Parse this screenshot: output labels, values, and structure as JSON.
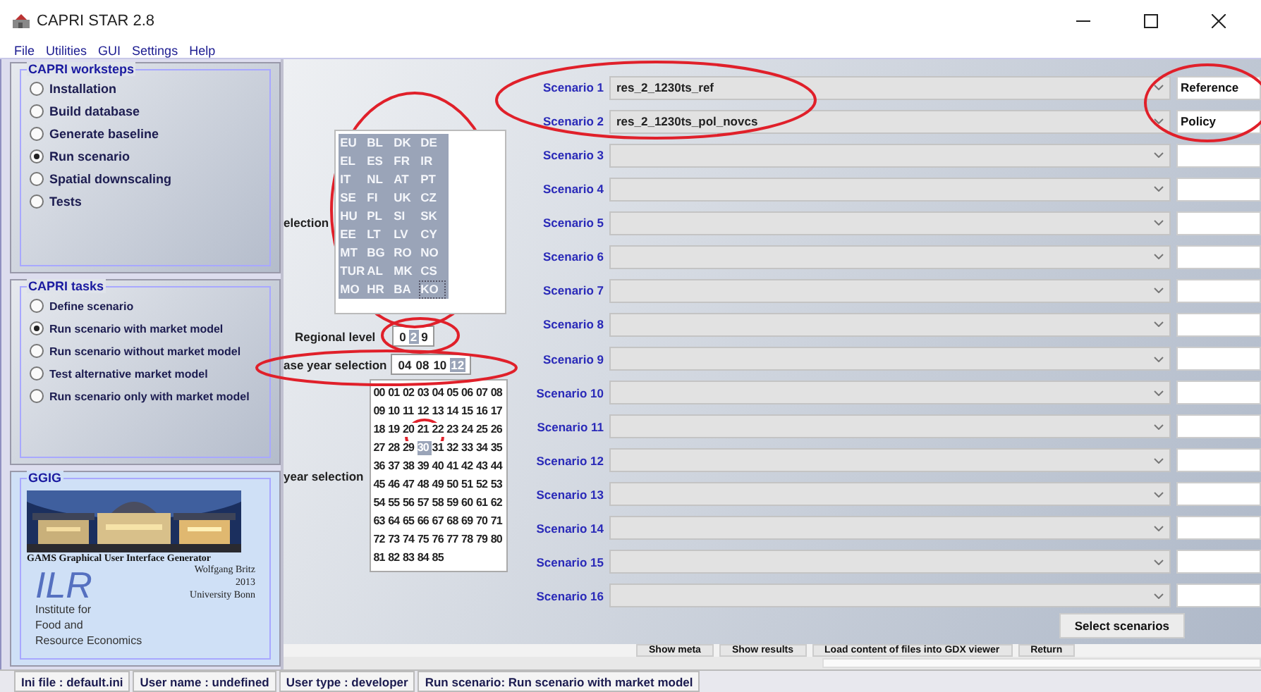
{
  "window": {
    "title": "CAPRI STAR 2.8"
  },
  "menu": [
    "File",
    "Utilities",
    "GUI",
    "Settings",
    "Help"
  ],
  "worksteps": {
    "title": "CAPRI worksteps",
    "items": [
      {
        "label": "Installation",
        "selected": false
      },
      {
        "label": "Build database",
        "selected": false
      },
      {
        "label": "Generate baseline",
        "selected": false
      },
      {
        "label": "Run scenario",
        "selected": true
      },
      {
        "label": "Spatial downscaling",
        "selected": false
      },
      {
        "label": "Tests",
        "selected": false
      }
    ]
  },
  "tasks": {
    "title": "CAPRI tasks",
    "items": [
      {
        "label": "Define scenario",
        "selected": false
      },
      {
        "label": "Run scenario with market model",
        "selected": true
      },
      {
        "label": "Run scenario without market model",
        "selected": false
      },
      {
        "label": "Test alternative market model",
        "selected": false
      },
      {
        "label": "Run scenario only with market model",
        "selected": false
      }
    ]
  },
  "about": {
    "title": "GGIG",
    "generator": "GAMS Graphical User Interface Generator",
    "author": "Wolfgang Britz",
    "year": "2013",
    "university": "University Bonn",
    "logo": "ILR",
    "institute": [
      "Institute  for",
      "Food and",
      "Resource Economics"
    ]
  },
  "regions": {
    "label": "election",
    "items": [
      {
        "code": "EU",
        "selected": true
      },
      {
        "code": "BL",
        "selected": true
      },
      {
        "code": "DK",
        "selected": true
      },
      {
        "code": "DE",
        "selected": true
      },
      {
        "code": "EL",
        "selected": true
      },
      {
        "code": "ES",
        "selected": true
      },
      {
        "code": "FR",
        "selected": true
      },
      {
        "code": "IR",
        "selected": true
      },
      {
        "code": "IT",
        "selected": true
      },
      {
        "code": "NL",
        "selected": true
      },
      {
        "code": "AT",
        "selected": true
      },
      {
        "code": "PT",
        "selected": true
      },
      {
        "code": "SE",
        "selected": true
      },
      {
        "code": "FI",
        "selected": true
      },
      {
        "code": "UK",
        "selected": true
      },
      {
        "code": "CZ",
        "selected": true
      },
      {
        "code": "HU",
        "selected": true
      },
      {
        "code": "PL",
        "selected": true
      },
      {
        "code": "SI",
        "selected": true
      },
      {
        "code": "SK",
        "selected": true
      },
      {
        "code": "EE",
        "selected": true
      },
      {
        "code": "LT",
        "selected": true
      },
      {
        "code": "LV",
        "selected": true
      },
      {
        "code": "CY",
        "selected": true
      },
      {
        "code": "MT",
        "selected": true
      },
      {
        "code": "BG",
        "selected": true
      },
      {
        "code": "RO",
        "selected": true
      },
      {
        "code": "NO",
        "selected": true
      },
      {
        "code": "TUR",
        "selected": true
      },
      {
        "code": "AL",
        "selected": true
      },
      {
        "code": "MK",
        "selected": true
      },
      {
        "code": "CS",
        "selected": true
      },
      {
        "code": "MO",
        "selected": true
      },
      {
        "code": "HR",
        "selected": true
      },
      {
        "code": "BA",
        "selected": true
      },
      {
        "code": "KO",
        "selected": true
      }
    ]
  },
  "regional_level": {
    "label": "Regional level",
    "values": [
      {
        "text": "0",
        "selected": false
      },
      {
        "text": "2",
        "selected": true
      },
      {
        "text": "9",
        "selected": false
      }
    ]
  },
  "base_year": {
    "label": "ase year selection",
    "values": [
      {
        "text": "04",
        "selected": false
      },
      {
        "text": "08",
        "selected": false
      },
      {
        "text": "10",
        "selected": false
      },
      {
        "text": "12",
        "selected": true
      }
    ]
  },
  "years": {
    "label": "year selection",
    "items": [
      {
        "text": "00",
        "selected": false
      },
      {
        "text": "01",
        "selected": false
      },
      {
        "text": "02",
        "selected": false
      },
      {
        "text": "03",
        "selected": false
      },
      {
        "text": "04",
        "selected": false
      },
      {
        "text": "05",
        "selected": false
      },
      {
        "text": "06",
        "selected": false
      },
      {
        "text": "07",
        "selected": false
      },
      {
        "text": "08",
        "selected": false
      },
      {
        "text": "09",
        "selected": false
      },
      {
        "text": "10",
        "selected": false
      },
      {
        "text": "11",
        "selected": false
      },
      {
        "text": "12",
        "selected": false
      },
      {
        "text": "13",
        "selected": false
      },
      {
        "text": "14",
        "selected": false
      },
      {
        "text": "15",
        "selected": false
      },
      {
        "text": "16",
        "selected": false
      },
      {
        "text": "17",
        "selected": false
      },
      {
        "text": "18",
        "selected": false
      },
      {
        "text": "19",
        "selected": false
      },
      {
        "text": "20",
        "selected": false
      },
      {
        "text": "21",
        "selected": false
      },
      {
        "text": "22",
        "selected": false
      },
      {
        "text": "23",
        "selected": false
      },
      {
        "text": "24",
        "selected": false
      },
      {
        "text": "25",
        "selected": false
      },
      {
        "text": "26",
        "selected": false
      },
      {
        "text": "27",
        "selected": false
      },
      {
        "text": "28",
        "selected": false
      },
      {
        "text": "29",
        "selected": false
      },
      {
        "text": "30",
        "selected": true
      },
      {
        "text": "31",
        "selected": false
      },
      {
        "text": "32",
        "selected": false
      },
      {
        "text": "33",
        "selected": false
      },
      {
        "text": "34",
        "selected": false
      },
      {
        "text": "35",
        "selected": false
      },
      {
        "text": "36",
        "selected": false
      },
      {
        "text": "37",
        "selected": false
      },
      {
        "text": "38",
        "selected": false
      },
      {
        "text": "39",
        "selected": false
      },
      {
        "text": "40",
        "selected": false
      },
      {
        "text": "41",
        "selected": false
      },
      {
        "text": "42",
        "selected": false
      },
      {
        "text": "43",
        "selected": false
      },
      {
        "text": "44",
        "selected": false
      },
      {
        "text": "45",
        "selected": false
      },
      {
        "text": "46",
        "selected": false
      },
      {
        "text": "47",
        "selected": false
      },
      {
        "text": "48",
        "selected": false
      },
      {
        "text": "49",
        "selected": false
      },
      {
        "text": "50",
        "selected": false
      },
      {
        "text": "51",
        "selected": false
      },
      {
        "text": "52",
        "selected": false
      },
      {
        "text": "53",
        "selected": false
      },
      {
        "text": "54",
        "selected": false
      },
      {
        "text": "55",
        "selected": false
      },
      {
        "text": "56",
        "selected": false
      },
      {
        "text": "57",
        "selected": false
      },
      {
        "text": "58",
        "selected": false
      },
      {
        "text": "59",
        "selected": false
      },
      {
        "text": "60",
        "selected": false
      },
      {
        "text": "61",
        "selected": false
      },
      {
        "text": "62",
        "selected": false
      },
      {
        "text": "63",
        "selected": false
      },
      {
        "text": "64",
        "selected": false
      },
      {
        "text": "65",
        "selected": false
      },
      {
        "text": "66",
        "selected": false
      },
      {
        "text": "67",
        "selected": false
      },
      {
        "text": "68",
        "selected": false
      },
      {
        "text": "69",
        "selected": false
      },
      {
        "text": "70",
        "selected": false
      },
      {
        "text": "71",
        "selected": false
      },
      {
        "text": "72",
        "selected": false
      },
      {
        "text": "73",
        "selected": false
      },
      {
        "text": "74",
        "selected": false
      },
      {
        "text": "75",
        "selected": false
      },
      {
        "text": "76",
        "selected": false
      },
      {
        "text": "77",
        "selected": false
      },
      {
        "text": "78",
        "selected": false
      },
      {
        "text": "79",
        "selected": false
      },
      {
        "text": "80",
        "selected": false
      },
      {
        "text": "81",
        "selected": false
      },
      {
        "text": "82",
        "selected": false
      },
      {
        "text": "83",
        "selected": false
      },
      {
        "text": "84",
        "selected": false
      },
      {
        "text": "85",
        "selected": false
      }
    ]
  },
  "scenarios": [
    {
      "label": "Scenario 1",
      "value": "res_2_1230ts_ref",
      "tag": "Reference"
    },
    {
      "label": "Scenario 2",
      "value": "res_2_1230ts_pol_novcs",
      "tag": "Policy"
    },
    {
      "label": "Scenario 3"
    },
    {
      "label": "Scenario 4"
    },
    {
      "label": "Scenario 5"
    },
    {
      "label": "Scenario 6"
    },
    {
      "label": "Scenario 7"
    },
    {
      "label": "Scenario 8"
    },
    {
      "label": "Scenario 9"
    },
    {
      "label": "Scenario 10"
    },
    {
      "label": "Scenario 11"
    },
    {
      "label": "Scenario 12"
    },
    {
      "label": "Scenario 13"
    },
    {
      "label": "Scenario 14"
    },
    {
      "label": "Scenario 15"
    },
    {
      "label": "Scenario 16"
    }
  ],
  "select_button": "Select scenarios",
  "actions": [
    "Show meta",
    "Show results",
    "Load content of files into GDX viewer",
    "Return"
  ],
  "annotations": [
    {
      "kind": "ellipse"
    },
    {
      "kind": "ellipse"
    },
    {
      "kind": "ellipse"
    },
    {
      "kind": "ellipse"
    },
    {
      "kind": "ellipse"
    },
    {
      "kind": "ellipse"
    }
  ],
  "status_bar": [
    "Ini file : default.ini",
    "User name : undefined",
    "User type : developer",
    "Run scenario: Run scenario with market model"
  ]
}
